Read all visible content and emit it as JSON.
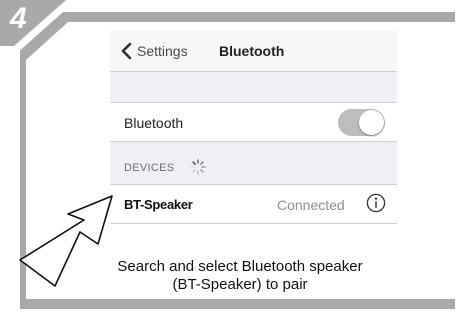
{
  "step": {
    "number": "4"
  },
  "navbar": {
    "back_label": "Settings",
    "title": "Bluetooth"
  },
  "bluetooth_row": {
    "label": "Bluetooth",
    "toggle_on": false
  },
  "devices_section": {
    "header": "DEVICES"
  },
  "device": {
    "name": "BT-Speaker",
    "status": "Connected"
  },
  "caption": {
    "line1": "Search and select Bluetooth speaker",
    "line2": "(BT-Speaker) to pair"
  },
  "icons": {
    "back": "chevron-left-icon",
    "spinner": "loading-spinner-icon",
    "info": "info-icon",
    "arrow": "pointer-arrow-icon"
  },
  "colors": {
    "frame_gray": "#a9a9a9",
    "toggle_off": "#bdbdbd",
    "section_bg": "#efeff4",
    "status_gray": "#8e8e93"
  }
}
